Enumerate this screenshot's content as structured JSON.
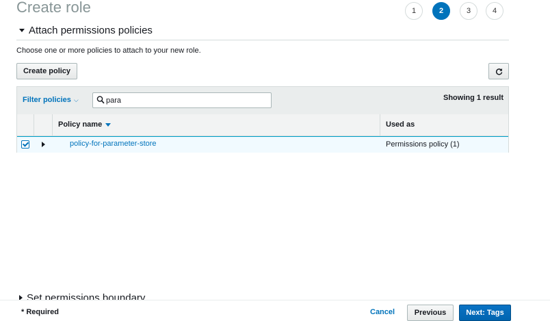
{
  "page": {
    "title": "Create role"
  },
  "steps": [
    {
      "label": "1",
      "active": false
    },
    {
      "label": "2",
      "active": true
    },
    {
      "label": "3",
      "active": false
    },
    {
      "label": "4",
      "active": false
    }
  ],
  "section": {
    "title": "Attach permissions policies",
    "description": "Choose one or more policies to attach to your new role."
  },
  "toolbar": {
    "create_policy_label": "Create policy",
    "refresh_icon": "refresh-icon"
  },
  "filter": {
    "label": "Filter policies",
    "chevron": "⌵",
    "search_value": "para",
    "result_text": "Showing 1 result"
  },
  "table": {
    "columns": [
      "Policy name",
      "Used as"
    ],
    "rows": [
      {
        "checked": true,
        "name": "policy-for-parameter-store",
        "used_as": "Permissions policy (1)"
      }
    ]
  },
  "boundary": {
    "title": "Set permissions boundary"
  },
  "footer": {
    "required_text": "* Required",
    "cancel_label": "Cancel",
    "previous_label": "Previous",
    "next_label": "Next: Tags"
  },
  "colors": {
    "accent": "#0073bb",
    "row_selected": "#f1faff",
    "header_bg": "#eaeded"
  }
}
